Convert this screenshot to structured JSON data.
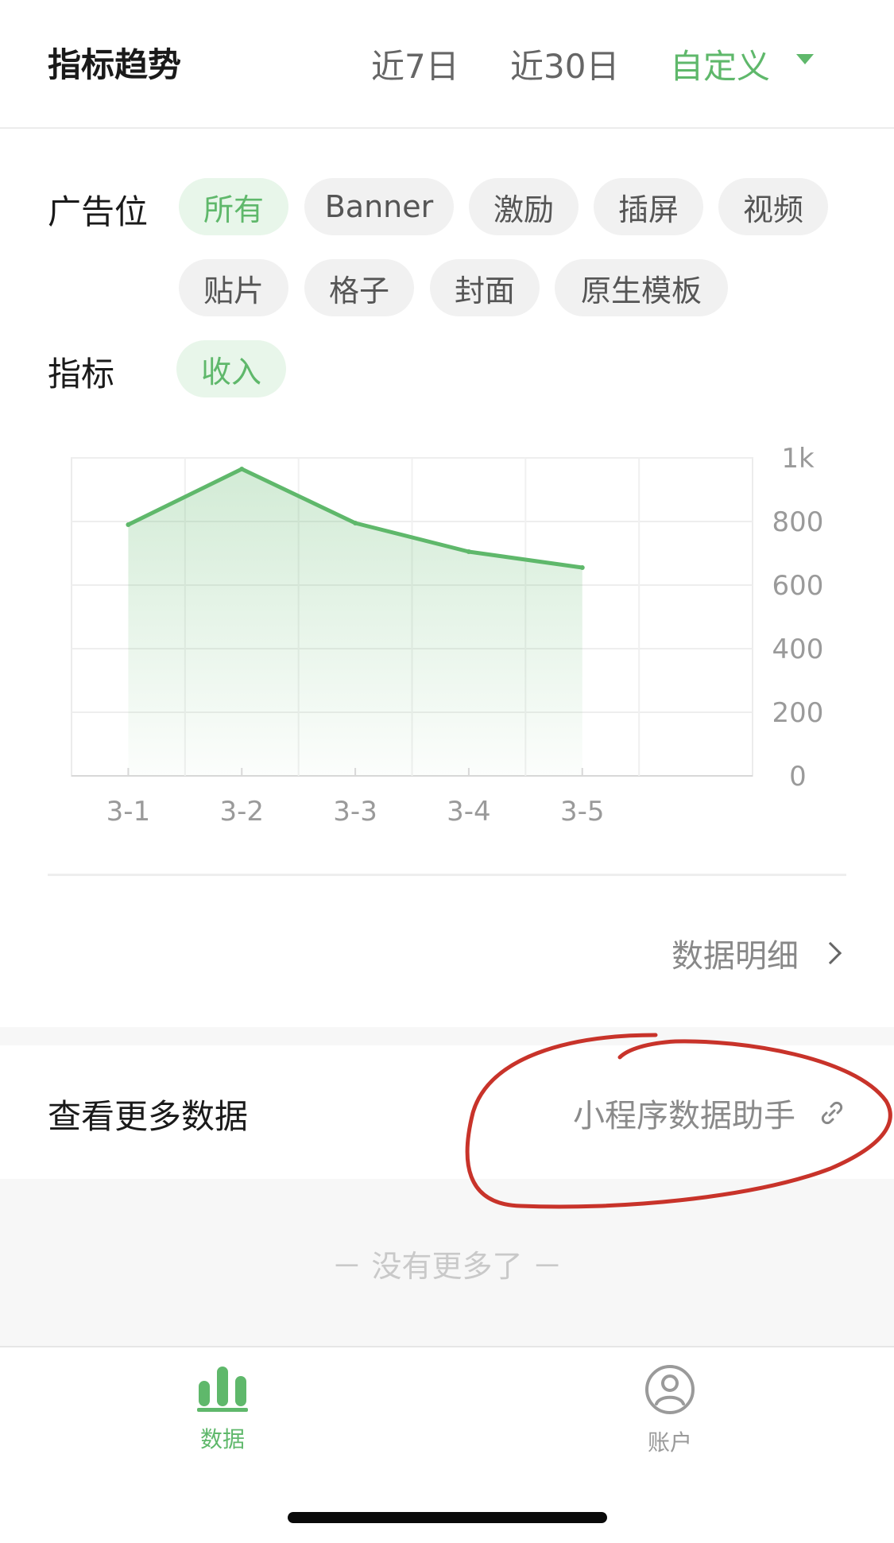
{
  "header": {
    "title": "指标趋势",
    "ranges": [
      "近7日",
      "近30日",
      "自定义"
    ]
  },
  "filters": {
    "ad_slot_label": "广告位",
    "ad_slots": [
      "所有",
      "Banner",
      "激励",
      "插屏",
      "视频",
      "贴片",
      "格子",
      "封面",
      "原生模板"
    ],
    "selected_ad_slot": "所有",
    "metric_label": "指标",
    "metrics": [
      "收入"
    ],
    "selected_metric": "收入"
  },
  "chart_data": {
    "type": "area",
    "categories": [
      "3-1",
      "3-2",
      "3-3",
      "3-4",
      "3-5"
    ],
    "values": [
      790,
      965,
      795,
      705,
      655
    ],
    "y_ticks": [
      "0",
      "200",
      "400",
      "600",
      "800",
      "1k"
    ],
    "ylim": [
      0,
      1000
    ],
    "grid": true,
    "y_axis_position": "right",
    "line_color": "#5fb86b"
  },
  "detail_link": "数据明细",
  "more": {
    "label": "查看更多数据",
    "assistant": "小程序数据助手"
  },
  "end_text": "－ 没有更多了 －",
  "tabbar": {
    "data_label": "数据",
    "account_label": "账户"
  },
  "colors": {
    "accent": "#5fb86b",
    "annotation": "#c8332a"
  }
}
